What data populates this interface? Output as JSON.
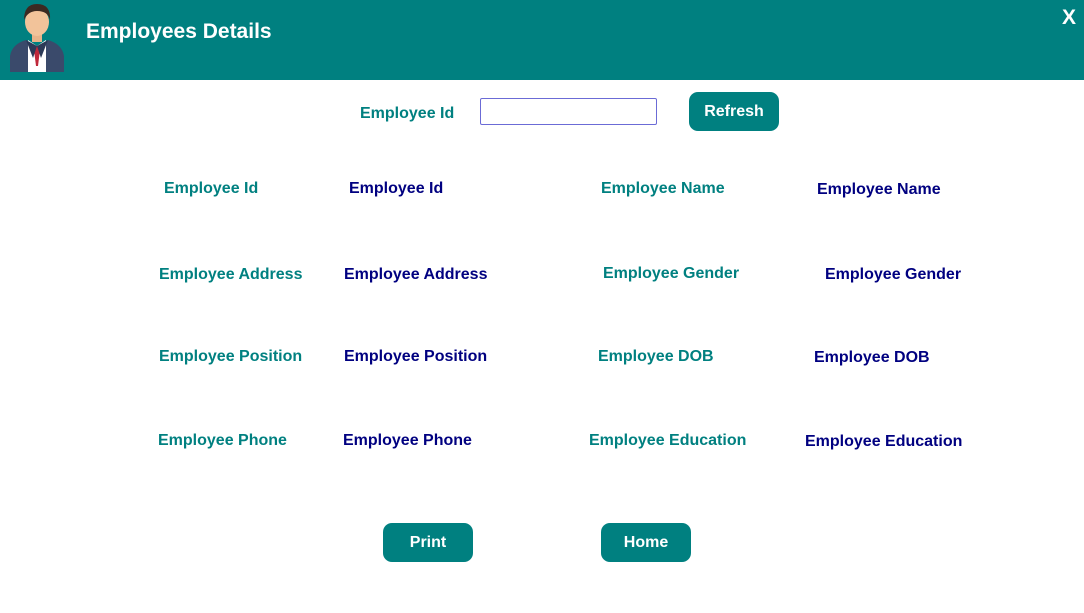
{
  "header": {
    "title": "Employees Details",
    "close_label": "X",
    "avatar_icon": "employee-avatar-icon"
  },
  "search": {
    "label": "Employee Id",
    "value": "",
    "placeholder": "",
    "refresh_label": "Refresh"
  },
  "details": {
    "id_label": "Employee Id",
    "id_value": "Employee Id",
    "name_label": "Employee Name",
    "name_value": "Employee Name",
    "address_label": "Employee Address",
    "address_value": "Employee Address",
    "gender_label": "Employee Gender",
    "gender_value": "Employee Gender",
    "position_label": "Employee Position",
    "position_value": "Employee Position",
    "dob_label": "Employee DOB",
    "dob_value": "Employee DOB",
    "phone_label": "Employee Phone",
    "phone_value": "Employee Phone",
    "education_label": "Employee Education",
    "education_value": "Employee Education"
  },
  "actions": {
    "print_label": "Print",
    "home_label": "Home"
  },
  "colors": {
    "primary": "#008080",
    "label_text": "#008080",
    "value_text": "#000080",
    "button_text": "#ffffff"
  }
}
